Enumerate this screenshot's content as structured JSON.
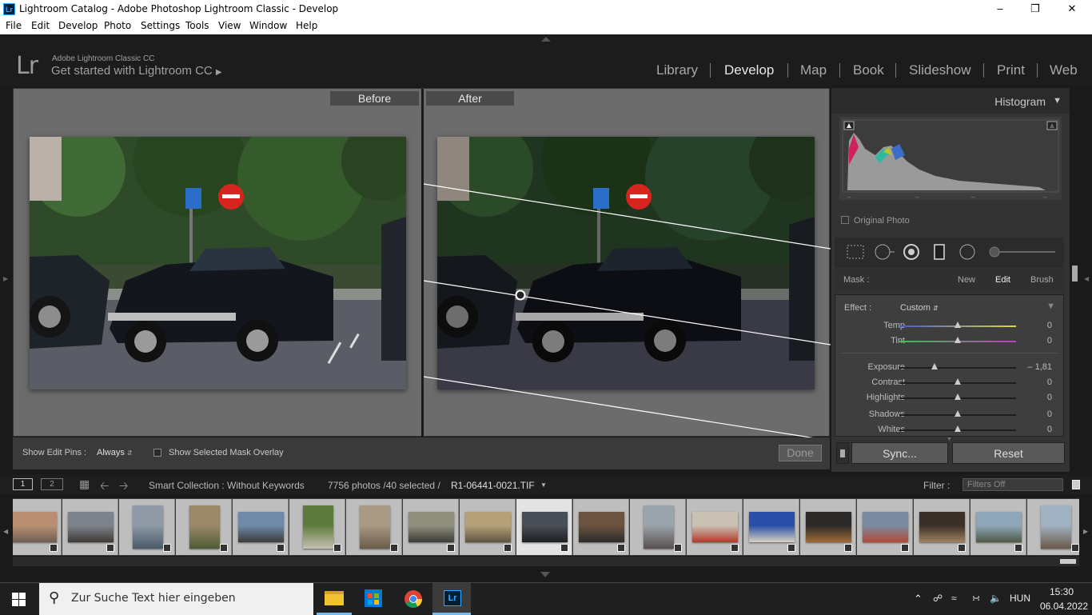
{
  "window": {
    "title": "Lightroom Catalog - Adobe Photoshop Lightroom Classic - Develop",
    "app_icon": "Lr"
  },
  "menu": [
    "File",
    "Edit",
    "Develop",
    "Photo",
    "Settings",
    "Tools",
    "View",
    "Window",
    "Help"
  ],
  "identity": {
    "logo": "Lr",
    "line1": "Adobe Lightroom Classic CC",
    "line2": "Get started with Lightroom CC"
  },
  "modules": [
    {
      "label": "Library",
      "active": false
    },
    {
      "label": "Develop",
      "active": true
    },
    {
      "label": "Map",
      "active": false
    },
    {
      "label": "Book",
      "active": false
    },
    {
      "label": "Slideshow",
      "active": false
    },
    {
      "label": "Print",
      "active": false
    },
    {
      "label": "Web",
      "active": false
    }
  ],
  "compare": {
    "before": "Before",
    "after": "After"
  },
  "editbar": {
    "pins_label": "Show Edit Pins :",
    "pins_value": "Always",
    "overlay_label": "Show Selected Mask Overlay",
    "done": "Done"
  },
  "histogram": {
    "title": "Histogram",
    "original": "Original Photo"
  },
  "mask": {
    "label": "Mask :",
    "new": "New",
    "edit": "Edit",
    "brush": "Brush"
  },
  "effect": {
    "label": "Effect :",
    "preset": "Custom",
    "sliders": [
      {
        "label": "Temp",
        "value": "0",
        "pos": 0.5
      },
      {
        "label": "Tint",
        "value": "0",
        "pos": 0.5
      },
      {
        "label": "Exposure",
        "value": "– 1,81",
        "pos": 0.3
      },
      {
        "label": "Contrast",
        "value": "0",
        "pos": 0.5
      },
      {
        "label": "Highlights",
        "value": "0",
        "pos": 0.5
      },
      {
        "label": "Shadows",
        "value": "0",
        "pos": 0.5
      },
      {
        "label": "Whites",
        "value": "0",
        "pos": 0.5
      }
    ]
  },
  "buttons": {
    "sync": "Sync...",
    "reset": "Reset"
  },
  "filmbar": {
    "view1": "1",
    "view2": "2",
    "source": "Smart Collection : Without Keywords",
    "count": "7756 photos /40 selected /",
    "filename": "R1-06441-0021.TIF",
    "filter_label": "Filter :",
    "filter_value": "Filters Off"
  },
  "taskbar": {
    "search_placeholder": "Zur Suche Text hier eingeben",
    "lang": "HUN",
    "time": "15:30",
    "date": "06.04.2022"
  },
  "colors": {
    "accent": "#31a8ff",
    "panel": "#333333",
    "canvas": "#6c6c6c"
  }
}
